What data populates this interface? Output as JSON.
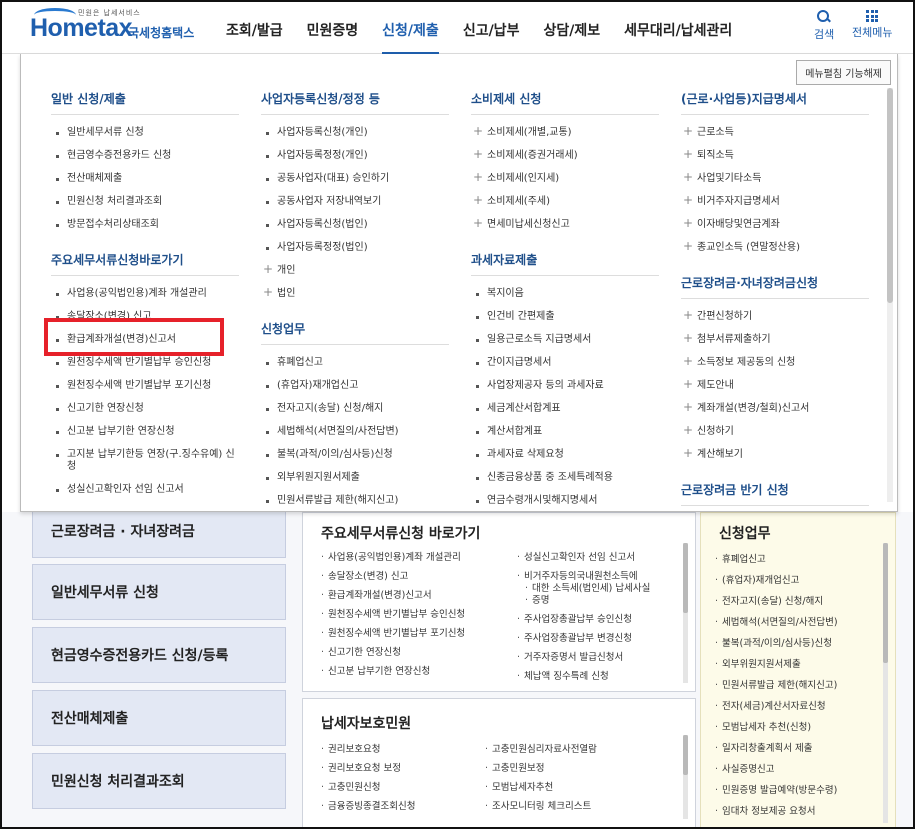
{
  "header": {
    "logo_small": "민원은 납세서비스",
    "logo_brand": "Hometax",
    "logo_kname": "국세청홈택스",
    "nav": [
      "조회/발급",
      "민원증명",
      "신청/제출",
      "신고/납부",
      "상담/제보",
      "세무대리/납세관리"
    ],
    "active_nav": "신청/제출",
    "search_label": "검색",
    "menu_label": "전체메뉴"
  },
  "mega": {
    "fix_button": "메뉴펼침 기능해제",
    "columns": [
      {
        "sections": [
          {
            "title": "일반 신청/제출",
            "items": [
              "일반세무서류 신청",
              "현금영수증전용카드 신청",
              "전산매체제출",
              "민원신청 처리결과조회",
              "방문접수처리상태조회"
            ]
          },
          {
            "title": "주요세무서류신청바로가기",
            "items": [
              "사업용(공익법인용)계좌 개설관리",
              "송달장소(변경) 신고",
              "환급계좌개설(변경)신고서",
              "원천징수세액 반기별납부 승인신청",
              "원천징수세액 반기별납부 포기신청",
              "신고기한 연장신청",
              "신고분 납부기한 연장신청",
              "고지분 납부기한등 연장(구.징수유예) 신청",
              "성실신고확인자 선임 신고서"
            ]
          }
        ]
      },
      {
        "sections": [
          {
            "title": "사업자등록신청/정정 등",
            "items": [
              "사업자등록신청(개인)",
              "사업자등록정정(개인)",
              "공동사업자(대표) 승인하기",
              "공동사업자 저장내역보기",
              "사업자등록신청(법인)",
              "사업자등록정정(법인)",
              "개인",
              "법인"
            ],
            "plus_from": 6
          },
          {
            "title": "신청업무",
            "items": [
              "휴폐업신고",
              "(휴업자)재개업신고",
              "전자고지(송달) 신청/해지",
              "세법해석(서면질의/사전답변)",
              "불복(과적/이의/심사등)신청",
              "외부위원지원서제출",
              "민원서류발급 제한(해지신고)"
            ]
          }
        ]
      },
      {
        "sections": [
          {
            "title": "소비제세 신청",
            "items": [
              "소비제세(개별,교통)",
              "소비제세(증권거래세)",
              "소비제세(인지세)",
              "소비제세(주세)",
              "면세미납세신청신고"
            ],
            "plus_from": 0
          },
          {
            "title": "과세자료제출",
            "items": [
              "복지이음",
              "인건비 간편제출",
              "일용근로소득 지급명세서",
              "간이지급명세서",
              "사업장제공자 등의 과세자료",
              "세금계산서합계표",
              "계산서합계표",
              "과세자료 삭제요청",
              "신종금융상품 중 조세특례적용",
              "연금수령개시및해지명세서"
            ]
          }
        ]
      },
      {
        "sections": [
          {
            "title": "(근로·사업등)지급명세서",
            "items": [
              "근로소득",
              "퇴직소득",
              "사업및기타소득",
              "비거주자지급명세서",
              "이자배당및연금계좌",
              "종교인소득 (연말정산용)"
            ],
            "plus_from": 0
          },
          {
            "title": "근로장려금·자녀장려금신청",
            "items": [
              "간편신청하기",
              "첨부서류제출하기",
              "소득정보 제공동의 신청",
              "제도안내",
              "계좌개설(변경/철회)신고서",
              "신청하기",
              "계산해보기"
            ],
            "plus_from": 0
          },
          {
            "title": "근로장려금 반기 신청",
            "items": []
          }
        ]
      }
    ]
  },
  "background": {
    "left_buttons": [
      "근로장려금 · 자녀장려금",
      "일반세무서류 신청",
      "현금영수증전용카드 신청/등록",
      "전산매체제출",
      "민원신청 처리결과조회"
    ],
    "panel1": {
      "title": "주요세무서류신청 바로가기",
      "left": [
        "사업용(공익법인용)계좌 개설관리",
        "송달장소(변경) 신고",
        "환급계좌개설(변경)신고서",
        "원천징수세액 반기별납부 승인신청",
        "원천징수세액 반기별납부 포기신청",
        "신고기한 연장신청",
        "신고분 납부기한 연장신청"
      ],
      "right": [
        "성실신고확인자 선임 신고서",
        "비거주자등의국내원천소득에",
        "대한 소득세(법인세) 납세사실",
        "증명",
        "주사업장총괄납부 승인신청",
        "주사업장총괄납부 변경신청",
        "거주자증명서 발급신청서",
        "체납액 징수특례 신청"
      ]
    },
    "panel2": {
      "title": "납세자보호민원",
      "left": [
        "권리보호요청",
        "권리보호요청 보정",
        "고충민원신청",
        "금융증빙종결조회신청"
      ],
      "right": [
        "고충민원심리자료사전열람",
        "고충민원보정",
        "모범납세자추천",
        "조사모니터링 체크리스트"
      ]
    },
    "panel3": {
      "title": "신청업무",
      "items": [
        "휴폐업신고",
        "(휴업자)재개업신고",
        "전자고지(송달) 신청/해지",
        "세법해석(서면질의/사전답변)",
        "불복(과적/이의/심사등)신청",
        "외부위원지원서제출",
        "민원서류발급 제한(해지신고)",
        "전자(세금)계산서자료신청",
        "모범납세자 추천(신청)",
        "일자리창출계획서 제출",
        "사실증명신고",
        "민원증명 발급예약(방문수령)",
        "임대차 정보제공 요청서"
      ]
    }
  }
}
